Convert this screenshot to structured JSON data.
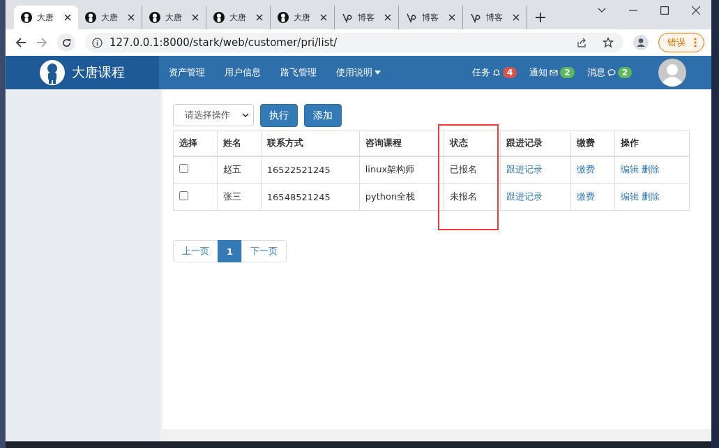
{
  "browser": {
    "tabs": [
      {
        "title": "大唐",
        "kind": "person",
        "selected": true
      },
      {
        "title": "大唐",
        "kind": "person",
        "selected": false
      },
      {
        "title": "大唐",
        "kind": "person",
        "selected": false
      },
      {
        "title": "大唐",
        "kind": "person",
        "selected": false
      },
      {
        "title": "大唐",
        "kind": "person",
        "selected": false
      },
      {
        "title": "博客",
        "kind": "blog",
        "selected": false
      },
      {
        "title": "博客",
        "kind": "blog",
        "selected": false
      },
      {
        "title": "博客",
        "kind": "blog",
        "selected": false
      }
    ],
    "url": "127.0.0.1:8000/stark/web/customer/pri/list/",
    "error_button": "错误"
  },
  "navbar": {
    "brand": "大唐课程",
    "menu": [
      {
        "label": "资产管理",
        "dropdown": false
      },
      {
        "label": "用户信息",
        "dropdown": false
      },
      {
        "label": "路飞管理",
        "dropdown": false
      },
      {
        "label": "使用说明",
        "dropdown": true
      }
    ],
    "notifications": [
      {
        "label": "任务",
        "kind": "bell",
        "count": "4",
        "color": "#d9534f"
      },
      {
        "label": "通知",
        "kind": "envelope",
        "count": "2",
        "color": "#5cb85c"
      },
      {
        "label": "消息",
        "kind": "comment",
        "count": "2",
        "color": "#5cb85c"
      }
    ]
  },
  "toolbar": {
    "action_select": {
      "placeholder": "请选择操作"
    },
    "buttons": [
      "执行",
      "添加"
    ]
  },
  "table": {
    "columns": [
      {
        "label": "选择",
        "kind": "plain"
      },
      {
        "label": "姓名",
        "kind": "plain"
      },
      {
        "label": "联系方式",
        "kind": "plain"
      },
      {
        "label": "咨询课程",
        "kind": "plain"
      },
      {
        "label": "状态",
        "kind": "framed"
      },
      {
        "label": "跟进记录",
        "kind": "plain"
      },
      {
        "label": "缴费",
        "kind": "plain"
      },
      {
        "label": "操作",
        "kind": "plain"
      }
    ],
    "rows": [
      {
        "checked": false,
        "name": "赵五",
        "phone": "16522521245",
        "course": "linux架构师",
        "status": "已报名",
        "follow_up": "跟进记录",
        "payment": "缴费",
        "edit": "编辑",
        "delete": "删除"
      },
      {
        "checked": false,
        "name": "张三",
        "phone": "16548521245",
        "course": "python全栈",
        "status": "未报名",
        "follow_up": "跟进记录",
        "payment": "缴费",
        "edit": "编辑",
        "delete": "删除"
      }
    ]
  },
  "pagination": [
    {
      "label": "上一页",
      "selected": false
    },
    {
      "label": "1",
      "selected": true
    },
    {
      "label": "下一页",
      "selected": false
    }
  ]
}
